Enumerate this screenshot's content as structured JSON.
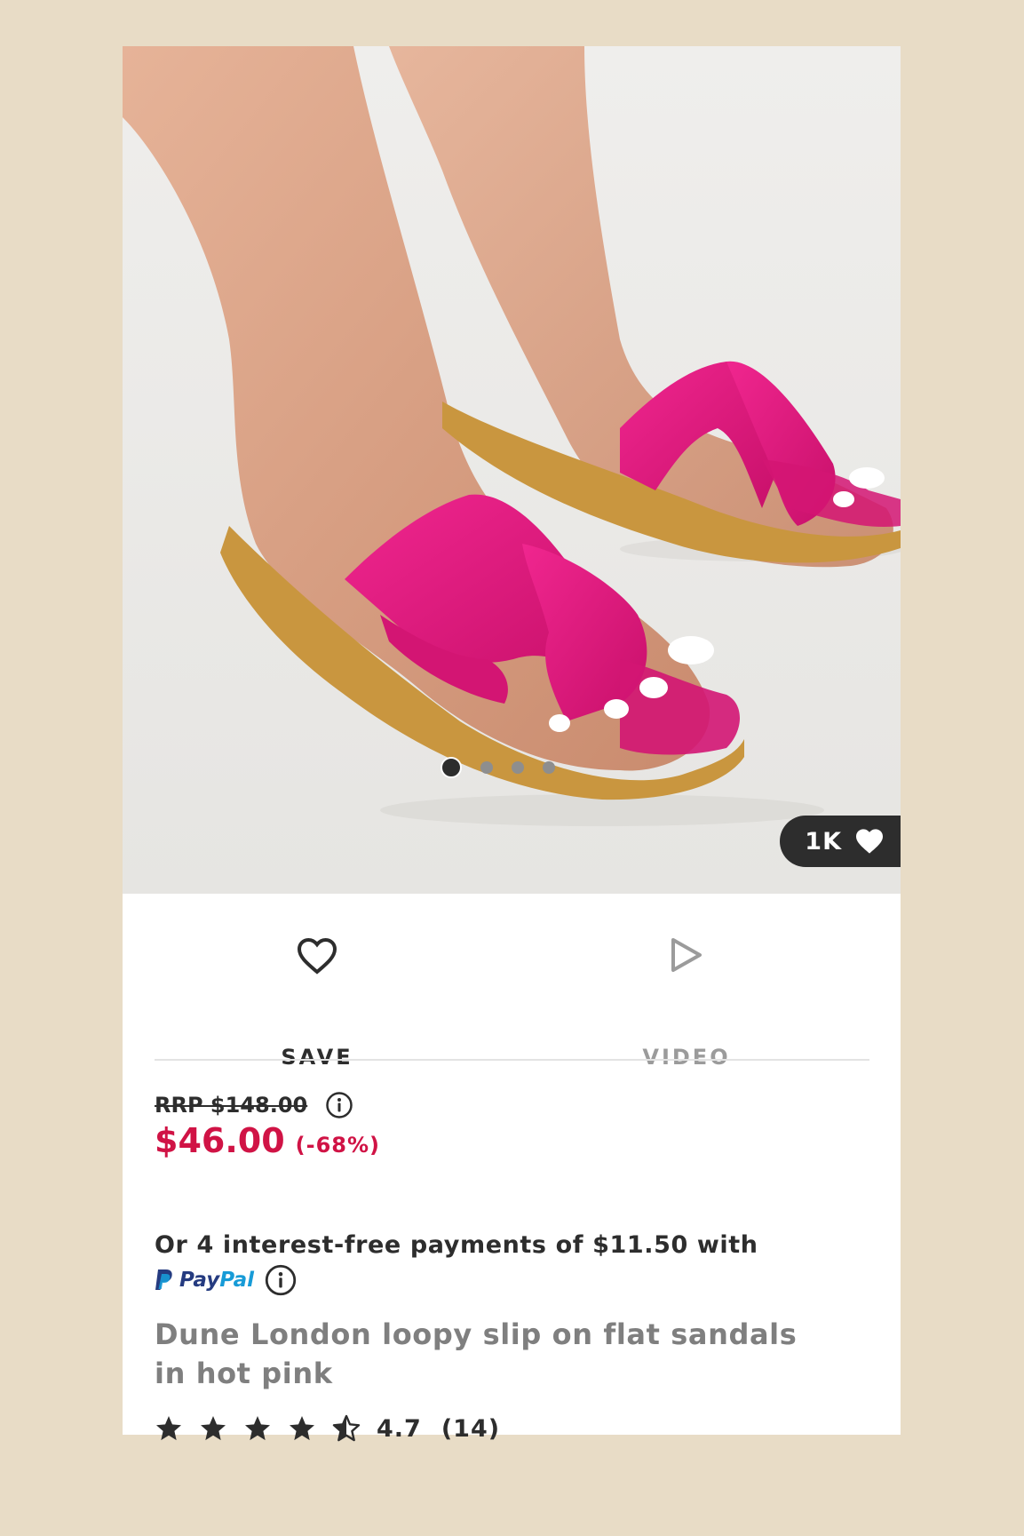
{
  "product": {
    "image": {
      "description_icon": "product-photo",
      "carousel_total": 4,
      "carousel_active": 1,
      "likes_label": "1K"
    },
    "actions": {
      "save_label": "SAVE",
      "video_label": "VIDEO"
    },
    "pricing": {
      "rrp": "RRP $148.00",
      "price": "$46.00",
      "discount": "(-68%)",
      "installment_text": "Or 4 interest-free payments of $11.50 with",
      "paypal_label_pay": "Pay",
      "paypal_label_pal": "Pal"
    },
    "title": "Dune London loopy slip on flat sandals in hot pink",
    "rating": {
      "value": "4.7",
      "count": "(14)",
      "stars": 4.5
    }
  },
  "colors": {
    "background": "#e8dcc6",
    "price_red": "#d01345",
    "sandal_pink": "#e0197f",
    "text_dark": "#2d2d2d",
    "text_grey": "#7f7f7f",
    "paypal_dark": "#253b80",
    "paypal_light": "#179bd7"
  }
}
